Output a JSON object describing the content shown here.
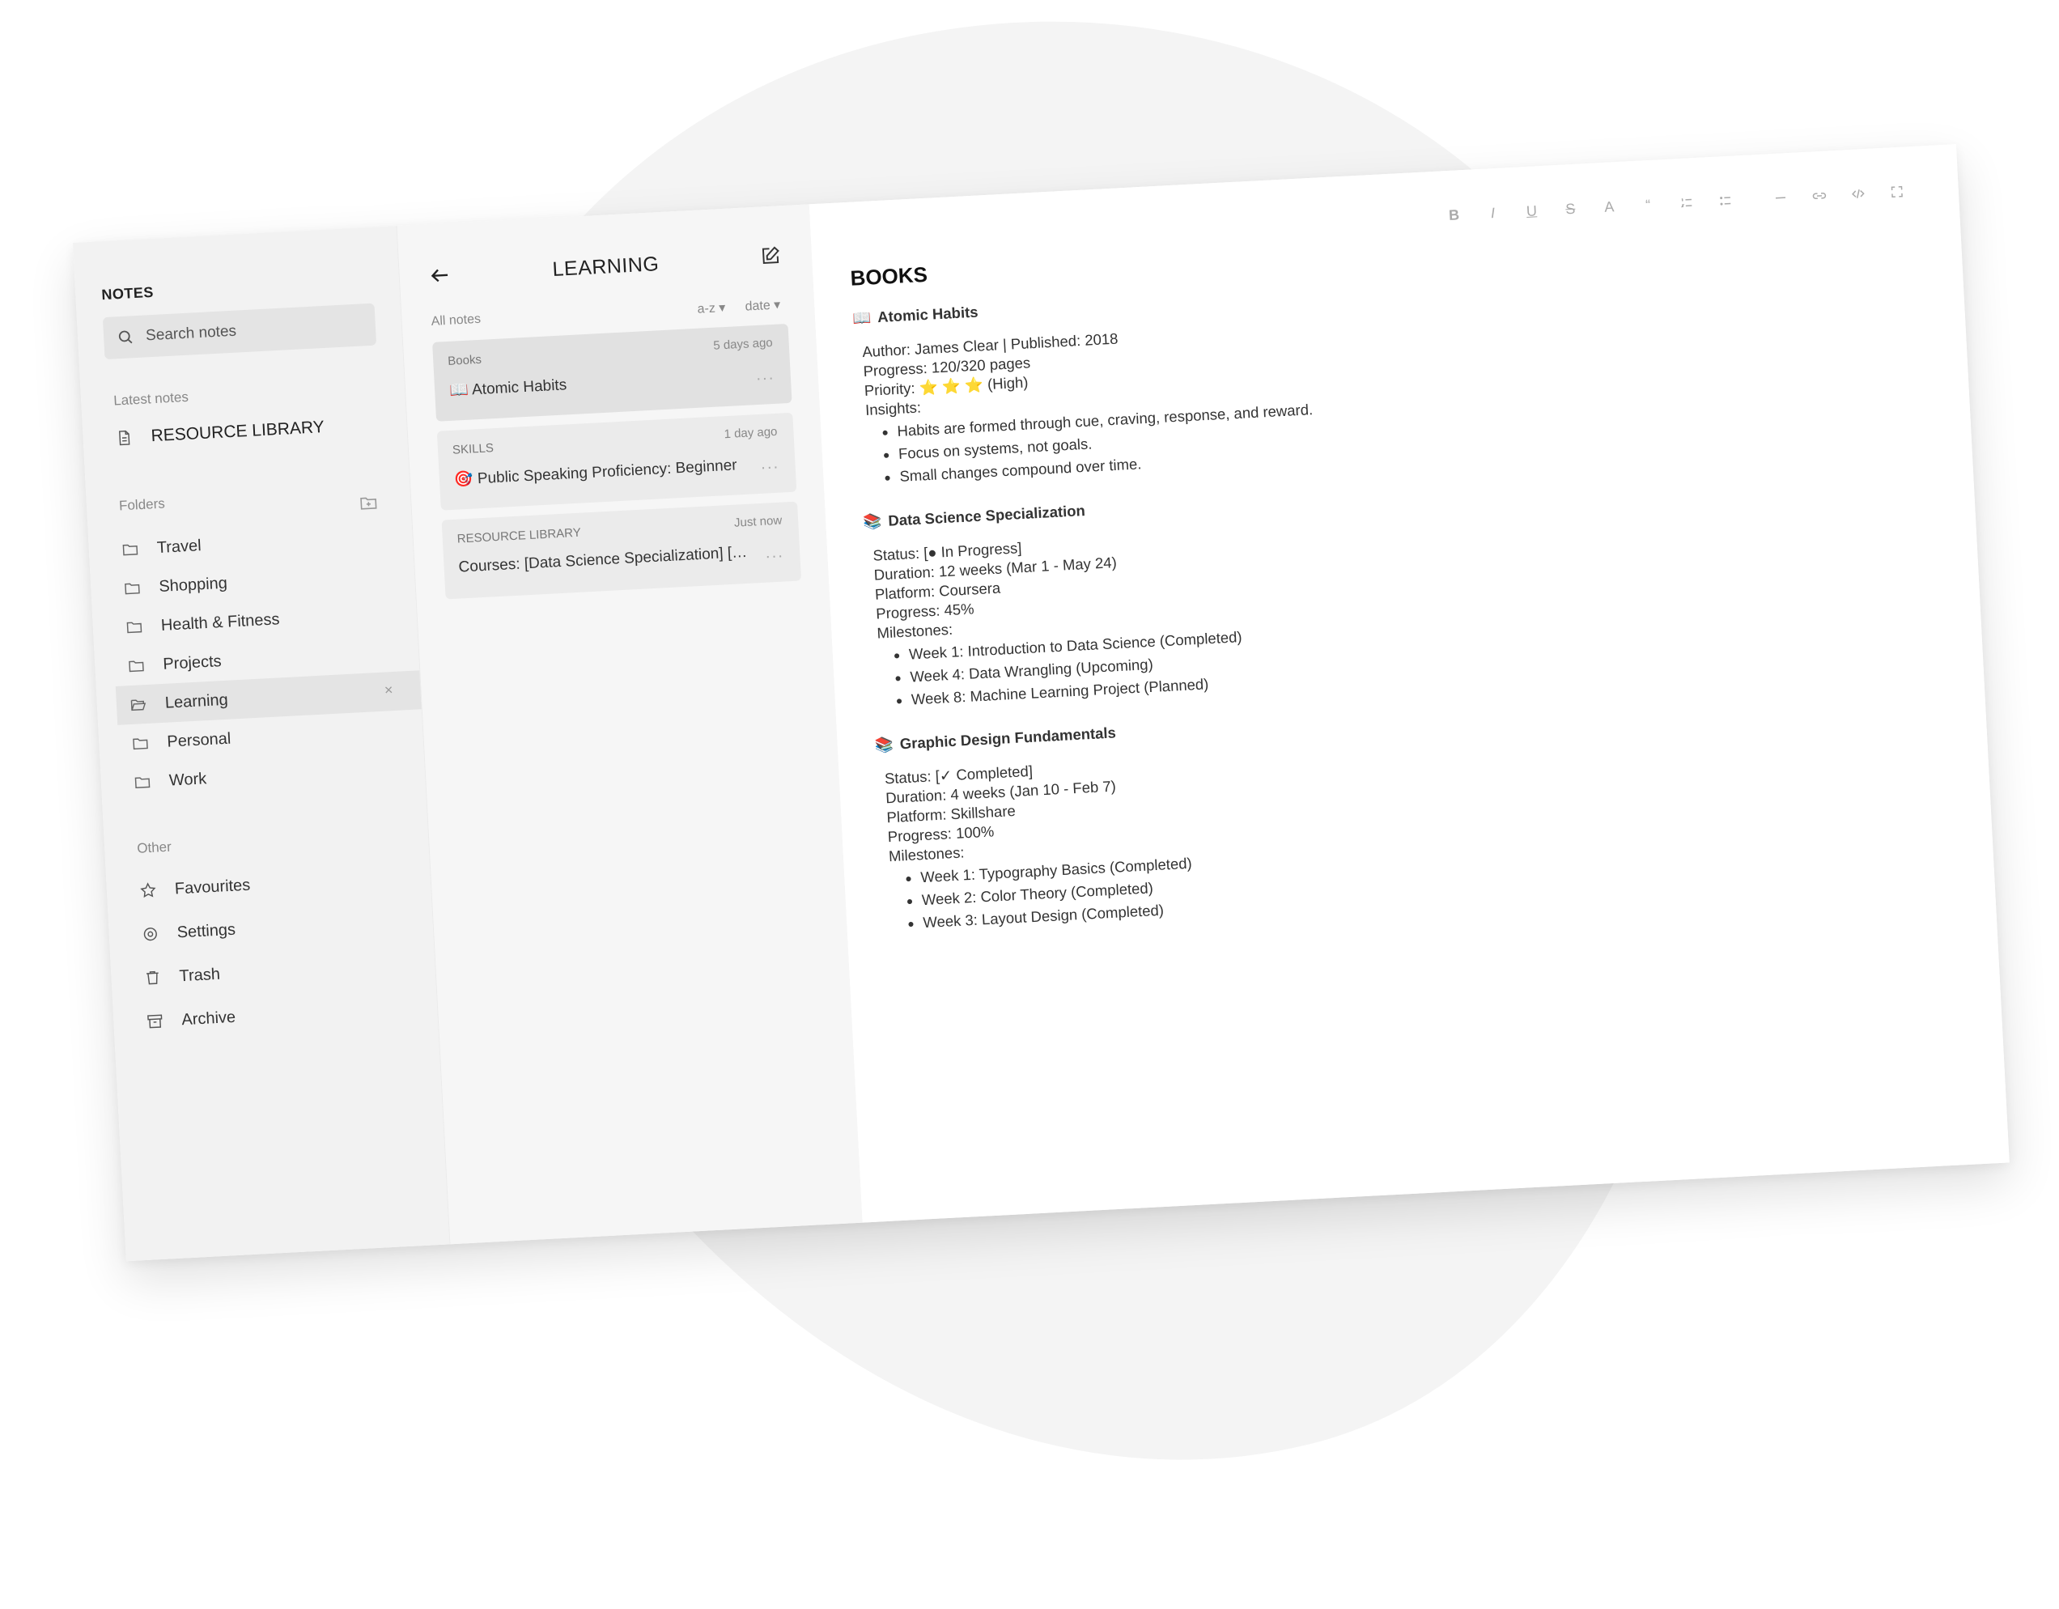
{
  "app": {
    "title": "NOTES"
  },
  "search": {
    "placeholder": "Search notes"
  },
  "sidebar": {
    "latest_label": "Latest notes",
    "latest_item": "RESOURCE LIBRARY",
    "folders_label": "Folders",
    "folders": [
      {
        "label": "Travel"
      },
      {
        "label": "Shopping"
      },
      {
        "label": "Health & Fitness"
      },
      {
        "label": "Projects"
      },
      {
        "label": "Learning",
        "active": true
      },
      {
        "label": "Personal"
      },
      {
        "label": "Work"
      }
    ],
    "close_glyph": "×",
    "other_label": "Other",
    "other": [
      {
        "label": "Favourites",
        "icon": "star-icon"
      },
      {
        "label": "Settings",
        "icon": "settings-icon"
      },
      {
        "label": "Trash",
        "icon": "trash-icon"
      },
      {
        "label": "Archive",
        "icon": "archive-icon"
      }
    ]
  },
  "notes_list": {
    "folder_title": "LEARNING",
    "all_notes_label": "All notes",
    "sort_az": "a-z ▾",
    "sort_date": "date ▾",
    "more_glyph": "···",
    "cards": [
      {
        "category": "Books",
        "time": "5 days ago",
        "emoji": "📖",
        "title": "Atomic Habits"
      },
      {
        "category": "SKILLS",
        "time": "1 day ago",
        "emoji": "🎯",
        "title": "Public Speaking Proficiency: Beginner"
      },
      {
        "category": "RESOURCE LIBRARY",
        "time": "Just now",
        "emoji": "",
        "title": "Courses: [Data Science Specialization] [Gra..."
      }
    ]
  },
  "toolbar": {
    "bold": "B",
    "italic": "I",
    "underline": "U",
    "strike": "S",
    "color": "A",
    "quote": "“"
  },
  "document": {
    "title": "BOOKS",
    "book1": {
      "emoji": "📖",
      "title": "Atomic Habits",
      "author": "Author: James Clear | Published: 2018",
      "progress": "Progress: 120/320 pages",
      "priority_label": "Priority:",
      "priority_stars": "⭐ ⭐ ⭐",
      "priority_text": "(High)",
      "insights_label": "Insights:",
      "insights": [
        "Habits are formed through cue, craving, response, and reward.",
        "Focus on systems, not goals.",
        "Small changes compound over time."
      ]
    },
    "course1": {
      "emoji": "📚",
      "title": "Data Science Specialization",
      "status": "Status: [● In Progress]",
      "duration": "Duration: 12 weeks (Mar 1 - May 24)",
      "platform": "Platform: Coursera",
      "progress": "Progress: 45%",
      "milestones_label": "Milestones:",
      "milestones": [
        "Week 1: Introduction to Data Science (Completed)",
        "Week 4: Data Wrangling (Upcoming)",
        "Week 8: Machine Learning Project (Planned)"
      ]
    },
    "course2": {
      "emoji": "📚",
      "title": "Graphic Design Fundamentals",
      "status": "Status: [✓ Completed]",
      "duration": "Duration: 4 weeks (Jan 10 - Feb 7)",
      "platform": "Platform: Skillshare",
      "progress": "Progress: 100%",
      "milestones_label": "Milestones:",
      "milestones": [
        "Week 1: Typography Basics (Completed)",
        "Week 2: Color Theory (Completed)",
        "Week 3: Layout Design (Completed)"
      ]
    }
  },
  "colors": {
    "sidebar_bg": "#f2f2f2",
    "list_bg": "#f6f6f6",
    "active_bg": "#e4e4e4",
    "star": "#f3c624"
  }
}
